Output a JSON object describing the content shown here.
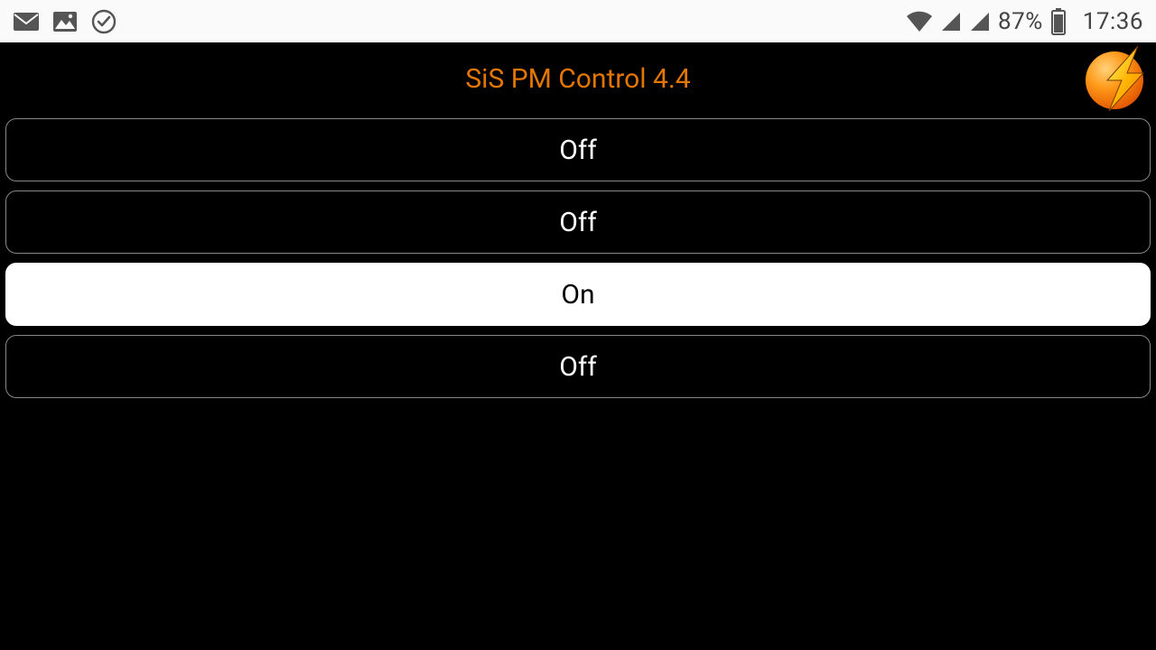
{
  "status_bar": {
    "battery_percent": "87%",
    "time": "17:36"
  },
  "header": {
    "title": "SiS PM Control 4.4"
  },
  "outlets": [
    {
      "label": "Off",
      "on": false
    },
    {
      "label": "Off",
      "on": false
    },
    {
      "label": "On",
      "on": true
    },
    {
      "label": "Off",
      "on": false
    }
  ]
}
